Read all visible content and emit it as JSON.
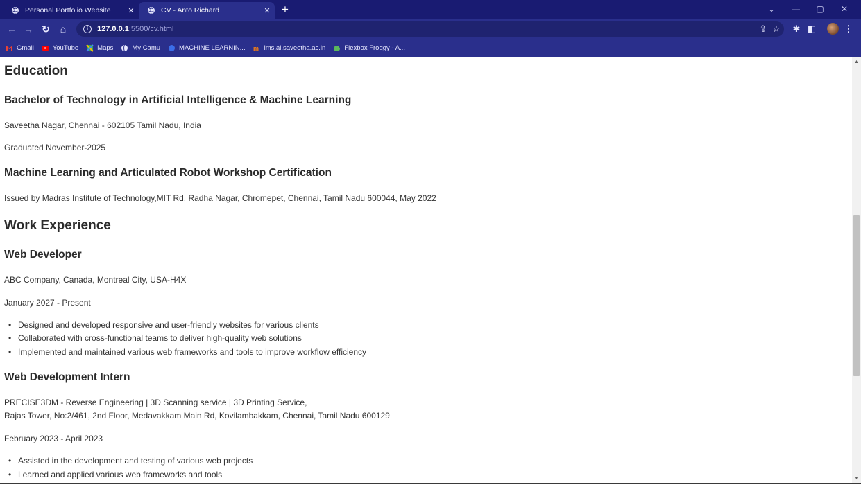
{
  "browser": {
    "tabs": [
      {
        "title": "Personal Portfolio Website",
        "active": false
      },
      {
        "title": "CV - Anto Richard",
        "active": true
      }
    ],
    "url_host": "127.0.0.1",
    "url_rest": ":5500/cv.html",
    "bookmarks": [
      {
        "label": "Gmail",
        "icon": "gmail-icon"
      },
      {
        "label": "YouTube",
        "icon": "youtube-icon"
      },
      {
        "label": "Maps",
        "icon": "maps-icon"
      },
      {
        "label": "My Camu",
        "icon": "globe-icon"
      },
      {
        "label": "MACHINE LEARNIN...",
        "icon": "blue-circle-icon"
      },
      {
        "label": "lms.ai.saveetha.ac.in",
        "icon": "moodle-icon"
      },
      {
        "label": "Flexbox Froggy - A...",
        "icon": "frog-icon"
      }
    ],
    "accent_color": "#2a2f8c"
  },
  "page": {
    "education": {
      "heading": "Education",
      "degree_title": "Bachelor of Technology in Artificial Intelligence & Machine Learning",
      "degree_location": "Saveetha Nagar, Chennai - 602105 Tamil Nadu, India",
      "degree_graduated": "Graduated November-2025",
      "cert_title": "Machine Learning and Articulated Robot Workshop Certification",
      "cert_issued": "Issued by Madras Institute of Technology,MIT Rd, Radha Nagar, Chromepet, Chennai, Tamil Nadu 600044, May 2022"
    },
    "work": {
      "heading": "Work Experience",
      "jobs": [
        {
          "title": "Web Developer",
          "company": "ABC Company, Canada, Montreal City, USA-H4X",
          "dates": "January 2027 - Present",
          "bullets": [
            "Designed and developed responsive and user-friendly websites for various clients",
            "Collaborated with cross-functional teams to deliver high-quality web solutions",
            "Implemented and maintained various web frameworks and tools to improve workflow efficiency"
          ]
        },
        {
          "title": "Web Development Intern",
          "company_line1": "PRECISE3DM - Reverse Engineering | 3D Scanning service | 3D Printing Service,",
          "company_line2": "Rajas Tower, No:2/461, 2nd Floor, Medavakkam Main Rd, Kovilambakkam, Chennai, Tamil Nadu 600129",
          "dates": "February 2023 - April 2023",
          "bullets": [
            "Assisted in the development and testing of various web projects",
            "Learned and applied various web frameworks and tools"
          ]
        }
      ]
    }
  }
}
